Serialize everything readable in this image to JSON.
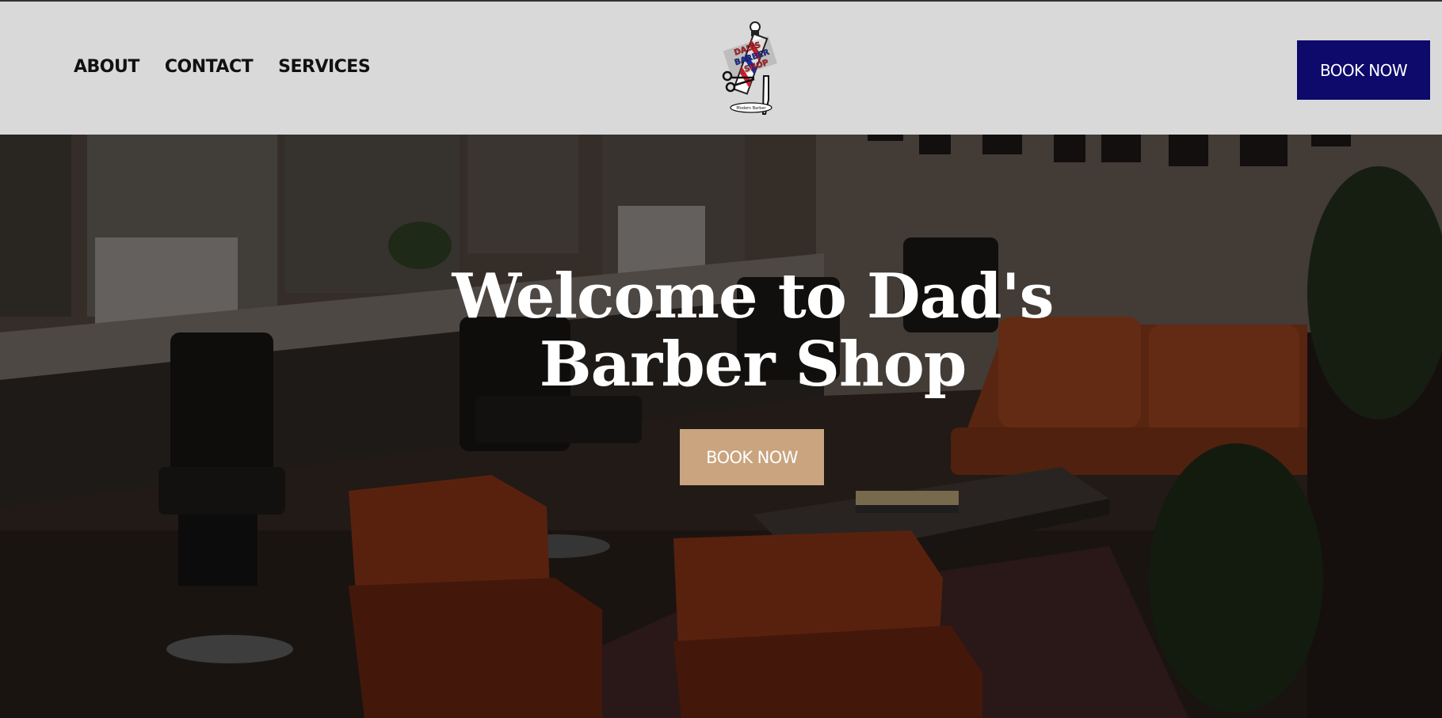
{
  "nav": {
    "items": [
      {
        "label": "ABOUT"
      },
      {
        "label": "CONTACT"
      },
      {
        "label": "SERVICES"
      }
    ]
  },
  "logo": {
    "icon": "barber-pole-logo-icon",
    "text_lines": [
      "DAD'S",
      "BARBER",
      "SHOP"
    ],
    "tagline": "Modern Barber"
  },
  "header": {
    "book_label": "BOOK NOW"
  },
  "hero": {
    "title_line1": "Welcome to Dad's",
    "title_line2": "Barber Shop",
    "book_label": "BOOK NOW"
  },
  "colors": {
    "header_bg": "#d9d9d9",
    "primary_button": "#0d0a6b",
    "hero_button": "#c9a47e",
    "text_dark": "#111111",
    "text_light": "#ffffff"
  }
}
